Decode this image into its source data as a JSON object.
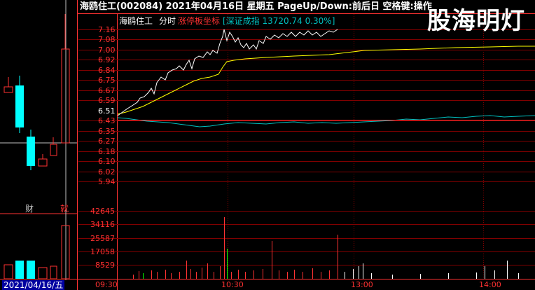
{
  "header": {
    "title": "海鸥住工(002084)  2021年04月16日 星期五 PageUp/Down:前后日 空格键:操作",
    "stock_name": "海鸥住工",
    "mode": "分时",
    "limit_axis": "涨停板坐标",
    "index_info": "[深证成指 13720.74 0.30%]",
    "brand": "股海明灯"
  },
  "left_panel": {
    "label_cai": "财",
    "label_su": "就",
    "date": "2021/04/16/五"
  },
  "price_axis": {
    "labels": [
      "7.16",
      "7.08",
      "7.00",
      "6.92",
      "6.84",
      "6.75",
      "6.67",
      "6.59",
      "6.51",
      "6.43",
      "6.35",
      "6.27",
      "6.18",
      "6.10",
      "6.02",
      "5.94"
    ],
    "reference": "6.51"
  },
  "volume_axis": {
    "labels": [
      "42645",
      "34116",
      "25587",
      "17058",
      "8529"
    ]
  },
  "time_axis": {
    "labels": [
      "09:30",
      "10:30",
      "13:00",
      "14:00"
    ]
  },
  "colors": {
    "up": "#ff3232",
    "down": "#00ffff",
    "price_line": "#ffffff",
    "avg_line": "#ffff00",
    "index_line": "#00c0c0",
    "grid": "#800000",
    "axis_text": "#ff3232",
    "vol_up": "#ff3232",
    "vol_down": "#00ff00"
  }
}
